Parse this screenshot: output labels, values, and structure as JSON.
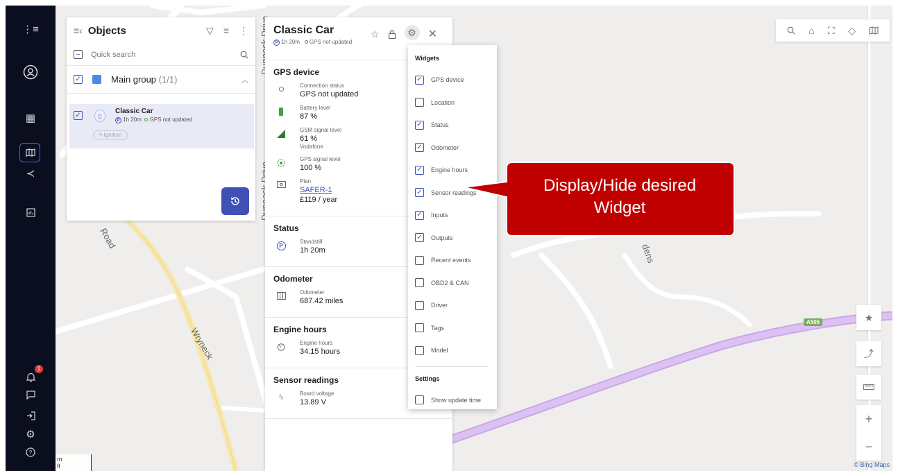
{
  "objects_panel": {
    "title": "Objects",
    "search_placeholder": "Quick search",
    "group": {
      "name": "Main group",
      "count": "(1/1)"
    },
    "vehicle": {
      "name": "Classic Car",
      "duration": "1h 20m",
      "gps_status": "GPS not updated",
      "chip": "Ignition"
    }
  },
  "detail_panel": {
    "title": "Classic Car",
    "duration": "1h 20m",
    "gps_status": "GPS not updated",
    "sections": {
      "gps_device": {
        "title": "GPS device",
        "connection_label": "Connection status",
        "connection_value": "GPS not updated",
        "battery_label": "Battery level",
        "battery_value": "87 %",
        "gsm_label": "GSM signal level",
        "gsm_value": "61 %",
        "gsm_operator": "Vodafone",
        "gps_signal_label": "GPS signal level",
        "gps_signal_value": "100 %",
        "plan_label": "Plan",
        "plan_value": "SAFER-1",
        "plan_price": "£119 / year"
      },
      "status": {
        "title": "Status",
        "label": "Standstill",
        "value": "1h 20m"
      },
      "odometer": {
        "title": "Odometer",
        "label": "Odometer",
        "value": "687.42 miles"
      },
      "engine_hours": {
        "title": "Engine hours",
        "label": "Engine hours",
        "value": "34.15 hours"
      },
      "sensor_readings": {
        "title": "Sensor readings",
        "label": "Board voltage",
        "value": "13.89 V"
      }
    }
  },
  "widgets_menu": {
    "heading": "Widgets",
    "items": [
      {
        "label": "GPS device",
        "checked": true
      },
      {
        "label": "Location",
        "checked": false
      },
      {
        "label": "Status",
        "checked": true
      },
      {
        "label": "Odometer",
        "checked": true
      },
      {
        "label": "Engine hours",
        "checked": true
      },
      {
        "label": "Sensor readings",
        "checked": true
      },
      {
        "label": "Inputs",
        "checked": true
      },
      {
        "label": "Outputs",
        "checked": true
      },
      {
        "label": "Recent events",
        "checked": false
      },
      {
        "label": "OBD2 & CAN",
        "checked": false
      },
      {
        "label": "Driver",
        "checked": false
      },
      {
        "label": "Tags",
        "checked": false
      },
      {
        "label": "Model",
        "checked": false
      }
    ],
    "settings_heading": "Settings",
    "settings_items": [
      {
        "label": "Show update time",
        "checked": false
      }
    ]
  },
  "callout": {
    "line1": "Display/Hide desired",
    "line2": "Widget",
    "color": "#c00000"
  },
  "map": {
    "labels": {
      "dunnock_top": "Dunnock Drive",
      "dunnock_mid": "Dunnock Drive",
      "road": "Road",
      "wryneck": "Wryneck",
      "gardens": "dens",
      "badge": "A505"
    },
    "attribution": "© Bing Maps",
    "scale_m": "m",
    "scale_ft": "ft"
  },
  "sidebar": {
    "notification_count": "1"
  }
}
